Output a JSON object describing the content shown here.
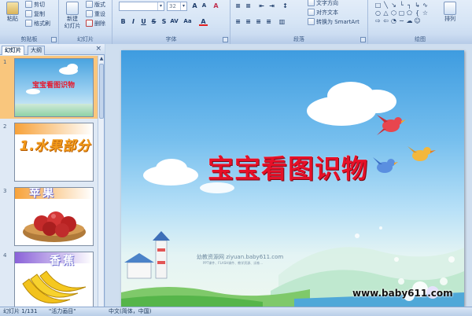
{
  "ribbon": {
    "clipboard": {
      "label": "剪贴板",
      "paste": "粘贴",
      "cut": "剪切",
      "copy": "复制",
      "format_painter": "格式刷"
    },
    "slides": {
      "label": "幻灯片",
      "new_slide": "新建\n幻灯片",
      "layout": "版式",
      "reset": "重设",
      "delete": "删除"
    },
    "font": {
      "label": "字体",
      "font_name": "",
      "font_size": "32"
    },
    "paragraph": {
      "label": "段落",
      "text_direction": "文字方向",
      "align_text": "对齐文本",
      "smartart": "转换为 SmartArt"
    },
    "drawing": {
      "label": "绘图",
      "arrange": "排列"
    }
  },
  "left_panel": {
    "tabs": [
      "幻灯片",
      "大纲"
    ],
    "slides": [
      {
        "num": "1",
        "title": "宝宝看图识物"
      },
      {
        "num": "2",
        "title": "1.水果部分"
      },
      {
        "num": "3",
        "title": "苹果"
      },
      {
        "num": "4",
        "title": "香蕉"
      }
    ]
  },
  "slide": {
    "title": "宝宝看图识物",
    "watermark": "幼教资源网 ziyuan.baby611.com",
    "watermark_sub": "PPT课件、FLASH课件、教学资源、试卷..."
  },
  "site_watermark": "www.baby611.com",
  "status": {
    "slide_info": "幻灯片 1/131",
    "theme": "\"活力画目\"",
    "language": "中文(简体，中国)"
  },
  "colors": {
    "ribbon_bg": "#d5e4f5",
    "selected_slide": "#f9c67d",
    "title_red": "#e61028"
  }
}
